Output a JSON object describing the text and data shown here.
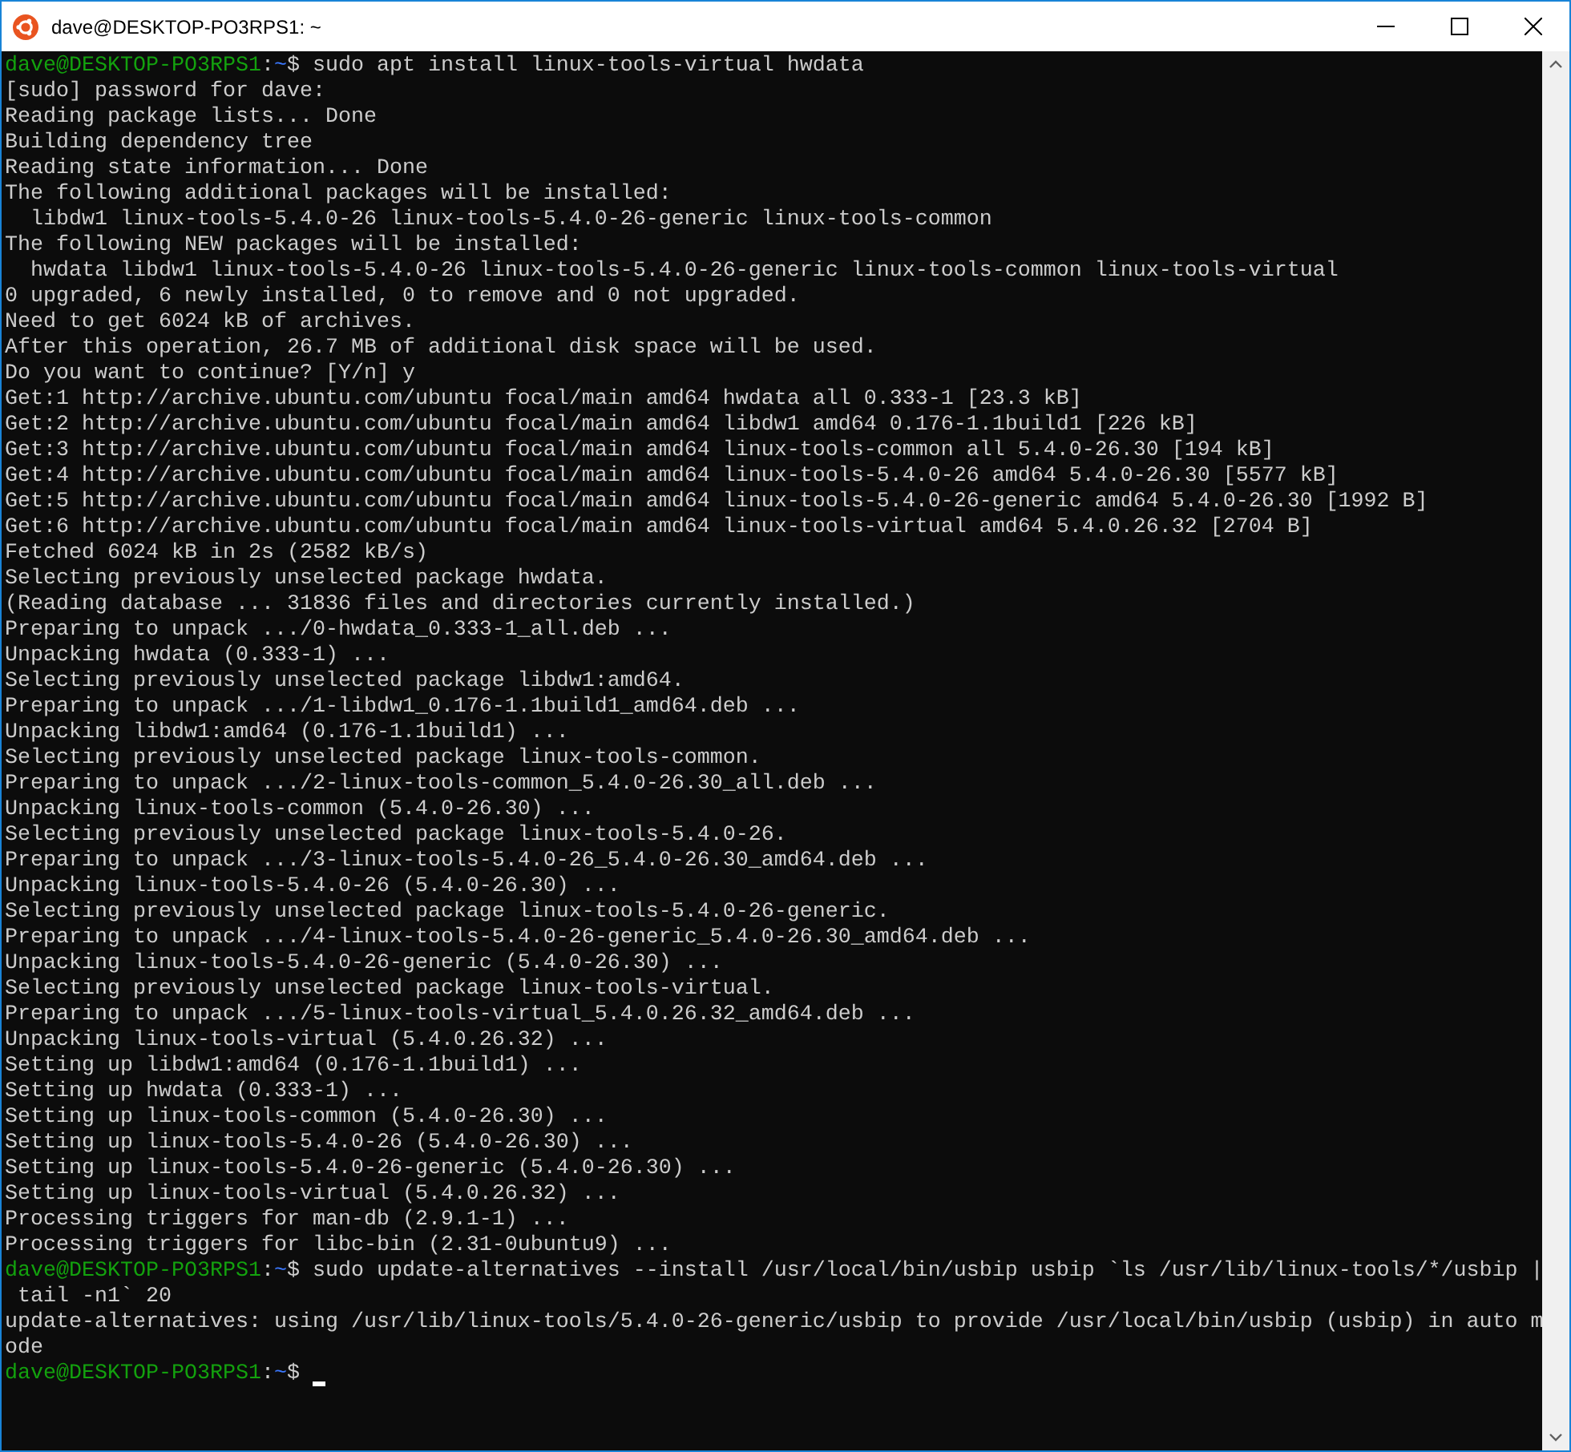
{
  "window": {
    "title": "dave@DESKTOP-PO3RPS1: ~"
  },
  "terminal": {
    "cursor_visible": true,
    "lines": [
      {
        "kind": "prompt",
        "user": "dave@DESKTOP-PO3RPS1",
        "sep": ":",
        "path": "~",
        "symbol": "$",
        "command": "sudo apt install linux-tools-virtual hwdata"
      },
      {
        "kind": "text",
        "text": "[sudo] password for dave:"
      },
      {
        "kind": "text",
        "text": "Reading package lists... Done"
      },
      {
        "kind": "text",
        "text": "Building dependency tree"
      },
      {
        "kind": "text",
        "text": "Reading state information... Done"
      },
      {
        "kind": "text",
        "text": "The following additional packages will be installed:"
      },
      {
        "kind": "text",
        "text": "  libdw1 linux-tools-5.4.0-26 linux-tools-5.4.0-26-generic linux-tools-common"
      },
      {
        "kind": "text",
        "text": "The following NEW packages will be installed:"
      },
      {
        "kind": "text",
        "text": "  hwdata libdw1 linux-tools-5.4.0-26 linux-tools-5.4.0-26-generic linux-tools-common linux-tools-virtual"
      },
      {
        "kind": "text",
        "text": "0 upgraded, 6 newly installed, 0 to remove and 0 not upgraded."
      },
      {
        "kind": "text",
        "text": "Need to get 6024 kB of archives."
      },
      {
        "kind": "text",
        "text": "After this operation, 26.7 MB of additional disk space will be used."
      },
      {
        "kind": "text",
        "text": "Do you want to continue? [Y/n] y"
      },
      {
        "kind": "text",
        "text": "Get:1 http://archive.ubuntu.com/ubuntu focal/main amd64 hwdata all 0.333-1 [23.3 kB]"
      },
      {
        "kind": "text",
        "text": "Get:2 http://archive.ubuntu.com/ubuntu focal/main amd64 libdw1 amd64 0.176-1.1build1 [226 kB]"
      },
      {
        "kind": "text",
        "text": "Get:3 http://archive.ubuntu.com/ubuntu focal/main amd64 linux-tools-common all 5.4.0-26.30 [194 kB]"
      },
      {
        "kind": "text",
        "text": "Get:4 http://archive.ubuntu.com/ubuntu focal/main amd64 linux-tools-5.4.0-26 amd64 5.4.0-26.30 [5577 kB]"
      },
      {
        "kind": "text",
        "text": "Get:5 http://archive.ubuntu.com/ubuntu focal/main amd64 linux-tools-5.4.0-26-generic amd64 5.4.0-26.30 [1992 B]"
      },
      {
        "kind": "text",
        "text": "Get:6 http://archive.ubuntu.com/ubuntu focal/main amd64 linux-tools-virtual amd64 5.4.0.26.32 [2704 B]"
      },
      {
        "kind": "text",
        "text": "Fetched 6024 kB in 2s (2582 kB/s)"
      },
      {
        "kind": "text",
        "text": "Selecting previously unselected package hwdata."
      },
      {
        "kind": "text",
        "text": "(Reading database ... 31836 files and directories currently installed.)"
      },
      {
        "kind": "text",
        "text": "Preparing to unpack .../0-hwdata_0.333-1_all.deb ..."
      },
      {
        "kind": "text",
        "text": "Unpacking hwdata (0.333-1) ..."
      },
      {
        "kind": "text",
        "text": "Selecting previously unselected package libdw1:amd64."
      },
      {
        "kind": "text",
        "text": "Preparing to unpack .../1-libdw1_0.176-1.1build1_amd64.deb ..."
      },
      {
        "kind": "text",
        "text": "Unpacking libdw1:amd64 (0.176-1.1build1) ..."
      },
      {
        "kind": "text",
        "text": "Selecting previously unselected package linux-tools-common."
      },
      {
        "kind": "text",
        "text": "Preparing to unpack .../2-linux-tools-common_5.4.0-26.30_all.deb ..."
      },
      {
        "kind": "text",
        "text": "Unpacking linux-tools-common (5.4.0-26.30) ..."
      },
      {
        "kind": "text",
        "text": "Selecting previously unselected package linux-tools-5.4.0-26."
      },
      {
        "kind": "text",
        "text": "Preparing to unpack .../3-linux-tools-5.4.0-26_5.4.0-26.30_amd64.deb ..."
      },
      {
        "kind": "text",
        "text": "Unpacking linux-tools-5.4.0-26 (5.4.0-26.30) ..."
      },
      {
        "kind": "text",
        "text": "Selecting previously unselected package linux-tools-5.4.0-26-generic."
      },
      {
        "kind": "text",
        "text": "Preparing to unpack .../4-linux-tools-5.4.0-26-generic_5.4.0-26.30_amd64.deb ..."
      },
      {
        "kind": "text",
        "text": "Unpacking linux-tools-5.4.0-26-generic (5.4.0-26.30) ..."
      },
      {
        "kind": "text",
        "text": "Selecting previously unselected package linux-tools-virtual."
      },
      {
        "kind": "text",
        "text": "Preparing to unpack .../5-linux-tools-virtual_5.4.0.26.32_amd64.deb ..."
      },
      {
        "kind": "text",
        "text": "Unpacking linux-tools-virtual (5.4.0.26.32) ..."
      },
      {
        "kind": "text",
        "text": "Setting up libdw1:amd64 (0.176-1.1build1) ..."
      },
      {
        "kind": "text",
        "text": "Setting up hwdata (0.333-1) ..."
      },
      {
        "kind": "text",
        "text": "Setting up linux-tools-common (5.4.0-26.30) ..."
      },
      {
        "kind": "text",
        "text": "Setting up linux-tools-5.4.0-26 (5.4.0-26.30) ..."
      },
      {
        "kind": "text",
        "text": "Setting up linux-tools-5.4.0-26-generic (5.4.0-26.30) ..."
      },
      {
        "kind": "text",
        "text": "Setting up linux-tools-virtual (5.4.0.26.32) ..."
      },
      {
        "kind": "text",
        "text": "Processing triggers for man-db (2.9.1-1) ..."
      },
      {
        "kind": "text",
        "text": "Processing triggers for libc-bin (2.31-0ubuntu9) ..."
      },
      {
        "kind": "prompt",
        "user": "dave@DESKTOP-PO3RPS1",
        "sep": ":",
        "path": "~",
        "symbol": "$",
        "command": "sudo update-alternatives --install /usr/local/bin/usbip usbip `ls /usr/lib/linux-tools/*/usbip |"
      },
      {
        "kind": "text",
        "text": " tail -n1` 20"
      },
      {
        "kind": "text",
        "text": "update-alternatives: using /usr/lib/linux-tools/5.4.0-26-generic/usbip to provide /usr/local/bin/usbip (usbip) in auto m"
      },
      {
        "kind": "text",
        "text": "ode"
      },
      {
        "kind": "prompt",
        "user": "dave@DESKTOP-PO3RPS1",
        "sep": ":",
        "path": "~",
        "symbol": "$"
      }
    ]
  }
}
